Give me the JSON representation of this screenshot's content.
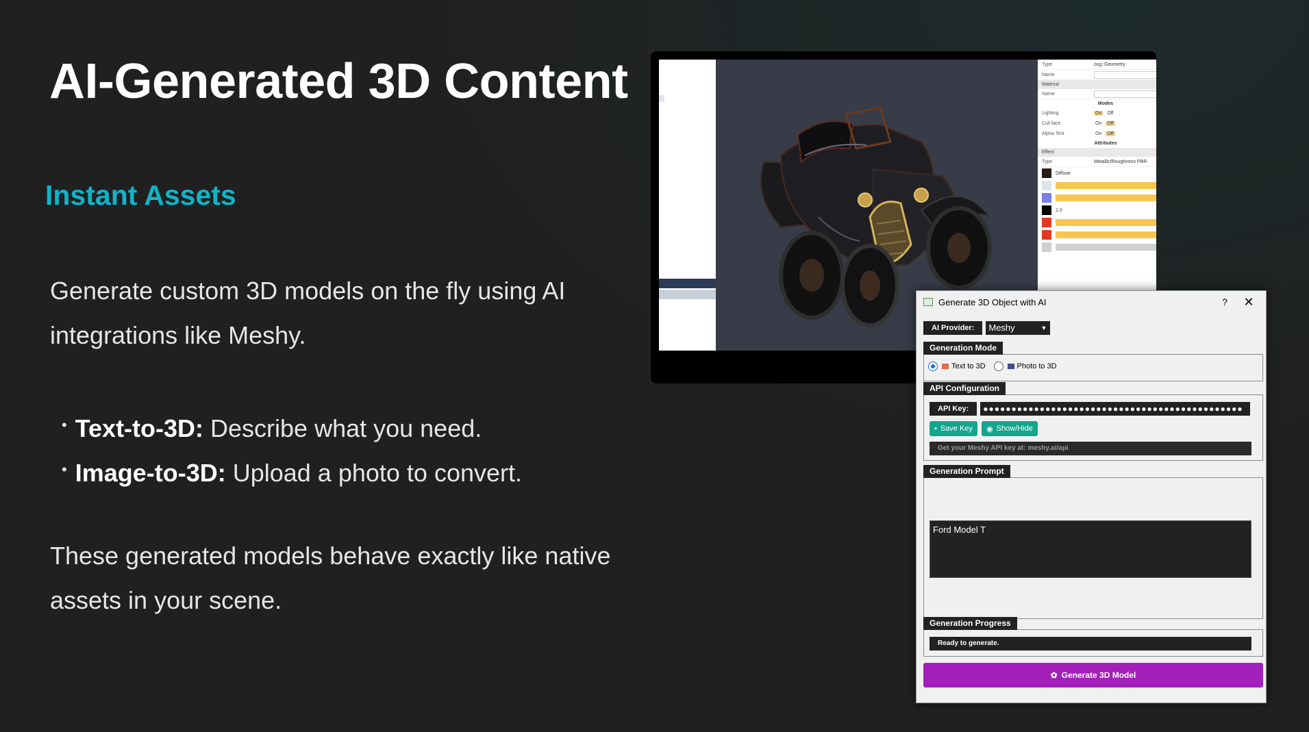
{
  "slide": {
    "title": "AI-Generated 3D Content",
    "subtitle": "Instant Assets",
    "intro": "Generate custom 3D models on the fly using AI integrations like Meshy.",
    "bullets": [
      {
        "bold": "Text-to-3D:",
        "text": "Describe what you need."
      },
      {
        "bold": "Image-to-3D:",
        "text": "Upload a photo to convert."
      }
    ],
    "closing": "These generated models behave exactly like native assets in your scene.",
    "colors": {
      "background": "#202020",
      "accent": "#10b4c8",
      "text": "#e6e6e6"
    }
  },
  "editor": {
    "props": {
      "type_label": "Type",
      "type_value": "osg::Geometry",
      "name_label": "Name",
      "material_header": "Material",
      "material_name_label": "Name",
      "modes_header": "Modes",
      "modes": [
        {
          "label": "Lighting",
          "on": "On",
          "off": "Off"
        },
        {
          "label": "Cull face",
          "on": "On",
          "off": "Off"
        },
        {
          "label": "Alpha Test",
          "on": "On",
          "off": "Off"
        }
      ],
      "attributes_header": "Attributes",
      "effect_header": "Effect",
      "effect_type_label": "Type",
      "effect_type_value": "Metallic/Roughness PBR",
      "diffuse_label": "Diffuse",
      "value_1": "1.0"
    }
  },
  "dialog": {
    "title": "Generate 3D Object with AI",
    "help": "?",
    "close": "✕",
    "provider_label": "AI Provider:",
    "provider_value": "Meshy",
    "generation_mode": {
      "label": "Generation Mode",
      "options": [
        "Text to 3D",
        "Photo to 3D"
      ],
      "selected": "Text to 3D"
    },
    "api": {
      "label": "API Configuration",
      "key_label": "API Key:",
      "key_value": "●●●●●●●●●●●●●●●●●●●●●●●●●●●●●●●●●●●●●●●●●●●●●●",
      "save_label": "Save Key",
      "show_label": "Show/Hide",
      "hint": "Get your Meshy API key at: meshy.ai/api"
    },
    "prompt": {
      "label": "Generation Prompt",
      "value": "Ford Model T"
    },
    "progress": {
      "label": "Generation Progress",
      "status": "Ready to generate."
    },
    "generate_label": "Generate 3D Model",
    "colors": {
      "dark_field": "#222222",
      "teal_button": "#13a58d",
      "generate_button": "#a21fb9",
      "radio_selected": "#1a6fd0"
    }
  }
}
